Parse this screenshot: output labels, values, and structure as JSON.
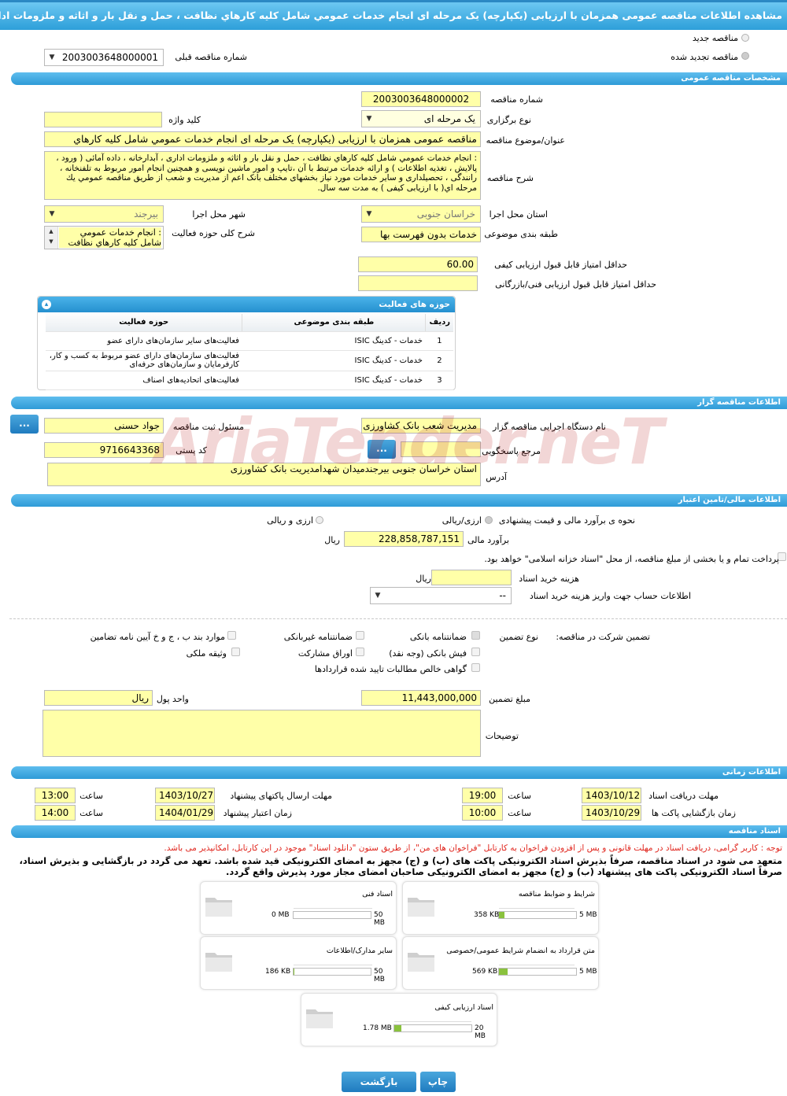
{
  "page": {
    "title": "مشاهده اطلاعات مناقصه عمومی همزمان با ارزیابی (یکپارچه) یک مرحله ای انجام خدمات عمومي شامل کليه کارهاي نظافت ، حمل و نقل بار و اثاثه و ملزومات اداری ، آبدارخانه"
  },
  "header": {
    "new_tender": "مناقصه جدید",
    "renewed_tender": "مناقصه تجدید شده",
    "prev_number_label": "شماره مناقصه قبلی",
    "prev_number_value": "2003003648000001"
  },
  "general": {
    "section_title": "مشخصات مناقصه عمومی",
    "number_label": "شماره مناقصه",
    "number_value": "2003003648000002",
    "type_label": "نوع برگزاری",
    "type_value": "یک مرحله ای",
    "keyword_label": "کلید واژه",
    "subject_label": "عنوان/موضوع مناقصه",
    "subject_value": "مناقصه عمومی همزمان با ارزیابی (یکپارچه) یک مرحله ای انجام خدمات عمومي شامل کليه کارهاي",
    "desc_label": "شرح مناقصه",
    "desc_value": ": انجام خدمات عمومي شامل کليه کارهاي نظافت ، حمل و نقل بار و اثاثه و ملزومات اداری ، آبدارخانه ، داده آمائی ( ورود ، پالایش ، تغذیه اطلاعات ) و ارائه خدمات مرتبط با آن ،تایپ و امور ماشین نویسی و همچنین انجام امور مربوط به تلفنخانه ، رانندگی ، تحصیلداری و سایر خدمات مورد نیاز بخشهای مختلف بانک اعم از مدیریت و شعب از طریق مناقصه عمومي يك مرحله اي( با ارزیابی کیفی ) به مدت سه سال.",
    "province_label": "استان محل اجرا",
    "province_value": "خراسان جنوبی",
    "city_label": "شهر محل اجرا",
    "city_value": "بیرجند",
    "category_label": "طبقه بندی موضوعی",
    "category_value": "خدمات بدون فهرست بها",
    "scope_label": "شرح کلی حوزه فعالیت",
    "scope_value": ": انجام خدمات عمومي شامل کليه کارهاي نظافت",
    "min_quality_label": "حداقل امتیاز قابل قبول ارزیابی کیفی",
    "min_quality_value": "60.00",
    "min_tech_label": "حداقل امتیاز قابل قبول ارزیابی فنی/بازرگانی",
    "min_tech_value": ""
  },
  "activities": {
    "title": "حوزه های فعالیت",
    "headers": [
      "ردیف",
      "طبقه بندی موضوعی",
      "حوزه فعالیت"
    ],
    "rows": [
      {
        "n": "1",
        "cat": "خدمات - کدینگ ISIC",
        "field": "فعالیت‌های سایر سازمان‌های دارای عضو"
      },
      {
        "n": "2",
        "cat": "خدمات - کدینگ ISIC",
        "field": "فعالیت‌های سازمان‌های دارای عضو مربوط به کسب و کار، کارفرمایان و سازمان‌های حرفه‌ای"
      },
      {
        "n": "3",
        "cat": "خدمات - کدینگ ISIC",
        "field": "فعالیت‌های اتحادیه‌های اصناف"
      }
    ]
  },
  "organizer": {
    "section_title": "اطلاعات مناقصه گزار",
    "org_label": "نام دستگاه اجرایی مناقصه گزار",
    "org_value": "مدیریت شعب بانک کشاورزی",
    "officer_label": "مسئول ثبت مناقصه",
    "officer_value": "جواد  حسنی",
    "ref_label": "مرجع پاسخگویی",
    "ref_value": "",
    "postal_label": "کد پستی",
    "postal_value": "9716643368",
    "address_label": "آدرس",
    "address_value": "استان خراسان جنوبی بیرجندمیدان شهدامدیریت بانک کشاورزی",
    "dots": "..."
  },
  "finance": {
    "section_title": "اطلاعات مالی/تامین اعتبار",
    "method_label": "نحوه ی برآورد مالی و قیمت پیشنهادی",
    "opt_rial": "ارزی/ریالی",
    "opt_mixed": "ارزی و ریالی",
    "estimate_label": "برآورد مالی",
    "estimate_value": "228,858,787,151",
    "rial": "ریال",
    "treasury_text": "پرداخت تمام و یا بخشی از مبلغ مناقصه، از محل \"اسناد خزانه اسلامی\" خواهد بود.",
    "doc_cost_label": "هزینه خرید اسناد",
    "doc_cost_value": "",
    "account_label": "اطلاعات حساب جهت واریز هزینه خرید اسناد",
    "account_value": "--"
  },
  "guarantee": {
    "participation_label": "تضمین شرکت در مناقصه:",
    "type_label": "نوع تضمین",
    "opts": {
      "bank_guarantee": "ضمانتنامه بانکی",
      "nonbank_guarantee": "ضمانتنامه غیربانکی",
      "bylaw_items": "موارد بند ب ، ج و خ آیین نامه تضامین",
      "cash_receipt": "فیش بانکی (وجه نقد)",
      "bonds": "اوراق مشارکت",
      "property": "وثیقه ملکی",
      "receivables": "گواهی خالص مطالبات تایید شده قراردادها"
    },
    "amount_label": "مبلغ تضمین",
    "amount_value": "11,443,000,000",
    "currency_label": "واحد پول",
    "currency_value": "ریال",
    "notes_label": "توضیحات",
    "notes_value": ""
  },
  "timing": {
    "section_title": "اطلاعات زمانی",
    "receive_label": "مهلت دریافت اسناد",
    "receive_date": "1403/10/12",
    "receive_time": "19:00",
    "submit_label": "مهلت ارسال پاکتهای پیشنهاد",
    "submit_date": "1403/10/27",
    "submit_time": "13:00",
    "open_label": "زمان بازگشایی پاکت ها",
    "open_date": "1403/10/29",
    "open_time": "10:00",
    "valid_label": "زمان اعتبار پیشنهاد",
    "valid_date": "1404/01/29",
    "valid_time": "14:00",
    "time_label": "ساعت"
  },
  "documents": {
    "section_title": "اسناد مناقصه",
    "note_red": "توجه : کاربر گرامی، دریافت اسناد در مهلت قانونی و پس از افزودن فراخوان به کارتابل \"فراخوان های من\"، از طریق ستون \"دانلود اسناد\" موجود در این کارتابل، امکانپذیر می باشد.",
    "note_bold": "متعهد می شود در اسناد مناقصه، صرفاً بذیرش اسناد الکترونیکی پاکت های (ب) و (ج) مجهز به امضای الکترونیکی قید شده باشد. تعهد می گردد در بازگشایی و بذیرش اسناد، صرفاً اسناد الکترونیکی پاکت های پیشنهاد (ب) و (ج) مجهز به امضای الکترونیکی صاحبان امضای مجاز مورد پذیرش واقع گردد.",
    "files": [
      {
        "name": "شرایط و ضوابط مناقصه",
        "size": "358 KB",
        "max": "5 MB",
        "fill": 0.07
      },
      {
        "name": "اسناد فنی",
        "size": "0 MB",
        "max": "50 MB",
        "fill": 0.0
      },
      {
        "name": "متن قرارداد به انضمام شرایط عمومی/خصوصی",
        "size": "569 KB",
        "max": "5 MB",
        "fill": 0.11
      },
      {
        "name": "سایر مدارک/اطلاعات",
        "size": "186 KB",
        "max": "50 MB",
        "fill": 0.004
      },
      {
        "name": "اسناد ارزیابی کیفی",
        "size": "1.78 MB",
        "max": "20 MB",
        "fill": 0.09
      }
    ]
  },
  "footer": {
    "print": "چاپ",
    "back": "بازگشت"
  },
  "watermark": "AriaTender.neT"
}
